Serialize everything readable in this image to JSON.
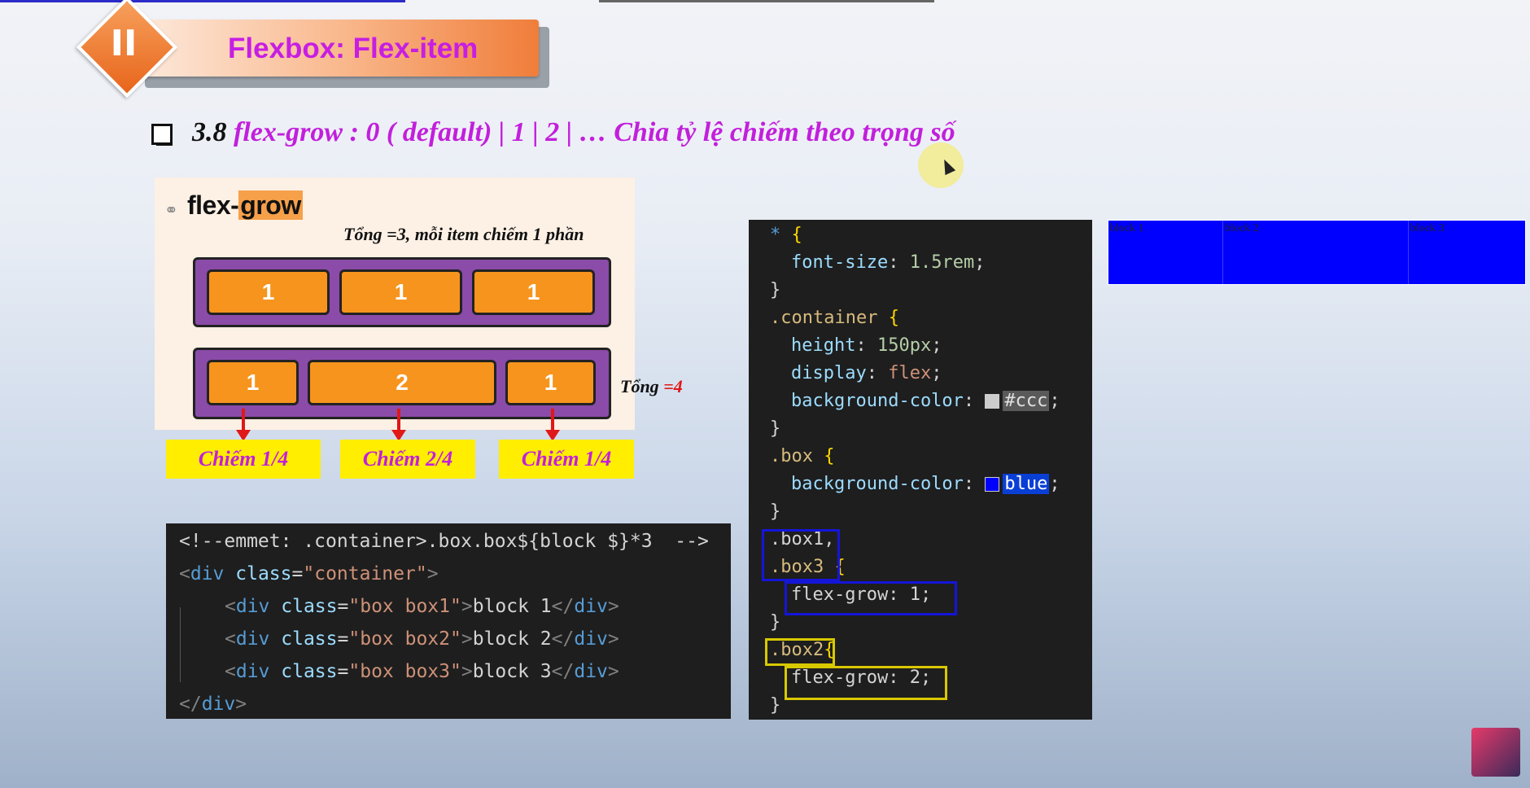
{
  "banner": {
    "numeral": "II",
    "title": "Flexbox: Flex-item"
  },
  "heading": {
    "number": "3.8",
    "text": "flex-grow :  0 ( default) |  1 | 2 | … Chia tỷ lệ chiếm theo trọng số"
  },
  "illustration": {
    "title_a": "flex-",
    "title_b": "grow",
    "note_top": "Tổng =3, mỗi item chiếm 1 phần",
    "row1": [
      "1",
      "1",
      "1"
    ],
    "row2": [
      "1",
      "2",
      "1"
    ],
    "total_label": "Tổng ",
    "total_value": "=4",
    "shares": [
      "Chiếm 1/4",
      "Chiếm 2/4",
      "Chiếm 1/4"
    ]
  },
  "html_code": {
    "line1": "<!--emmet: .container>.box.box${block $}*3  -->",
    "class_attr": "class",
    "container_cls": "\"container\"",
    "box1_cls": "\"box box1\"",
    "box2_cls": "\"box box2\"",
    "box3_cls": "\"box box3\"",
    "tag_div": "div",
    "block1": "block 1",
    "block2": "block 2",
    "block3": "block 3"
  },
  "css_code": {
    "star": "*",
    "font_size_prop": "font-size",
    "font_size_val": "1.5rem",
    "container_sel": ".container",
    "height_prop": "height",
    "height_val": "150px",
    "display_prop": "display",
    "display_val": "flex",
    "bg_prop": "background-color",
    "bg_ccc": "#ccc",
    "box_sel": ".box",
    "bg_blue": "blue",
    "box1_sel": ".box1,",
    "box3_sel": ".box3",
    "grow1": "flex-grow: 1;",
    "box2_sel": ".box2",
    "grow2": "flex-grow: 2;"
  },
  "preview": {
    "items": [
      "block 1",
      "block 2",
      "block 3"
    ]
  },
  "colors": {
    "accent_magenta": "#c21fdc",
    "banner_orange": "#f07d3a",
    "preview_blue": "#0000ff",
    "share_yellow": "#ffee00"
  }
}
